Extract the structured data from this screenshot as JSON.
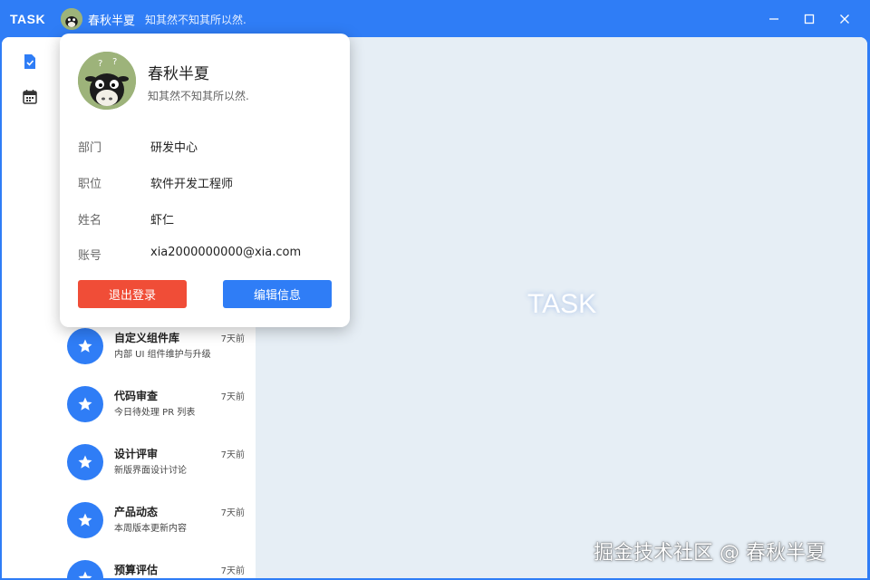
{
  "app": {
    "title": "TASK"
  },
  "user": {
    "name": "春秋半夏",
    "signature": "知其然不知其所以然."
  },
  "profile": {
    "fields": [
      {
        "label": "部门",
        "value": "研发中心"
      },
      {
        "label": "职位",
        "value": "软件开发工程师"
      },
      {
        "label": "姓名",
        "value": "虾仁"
      },
      {
        "label": "账号",
        "value": "xia2000000000@xia.com"
      }
    ],
    "logout_label": "退出登录",
    "edit_label": "编辑信息"
  },
  "nav": {
    "items": [
      {
        "icon": "task-icon"
      },
      {
        "icon": "calendar-icon"
      }
    ]
  },
  "tasks": [
    {
      "title": "自定义组件库",
      "subtitle": "内部 UI 组件维护与升级",
      "time": "7天前"
    },
    {
      "title": "代码审查",
      "subtitle": "今日待处理 PR 列表",
      "time": "7天前"
    },
    {
      "title": "设计评审",
      "subtitle": "新版界面设计讨论",
      "time": "7天前"
    },
    {
      "title": "产品动态",
      "subtitle": "本周版本更新内容",
      "time": "7天前"
    },
    {
      "title": "预算评估",
      "subtitle": "",
      "time": "7天前"
    }
  ],
  "main": {
    "logo": "TASK"
  },
  "watermark": "掘金技术社区 @ 春秋半夏",
  "colors": {
    "accent": "#2f7df6",
    "danger": "#f04d37",
    "background": "#e6eef5"
  }
}
